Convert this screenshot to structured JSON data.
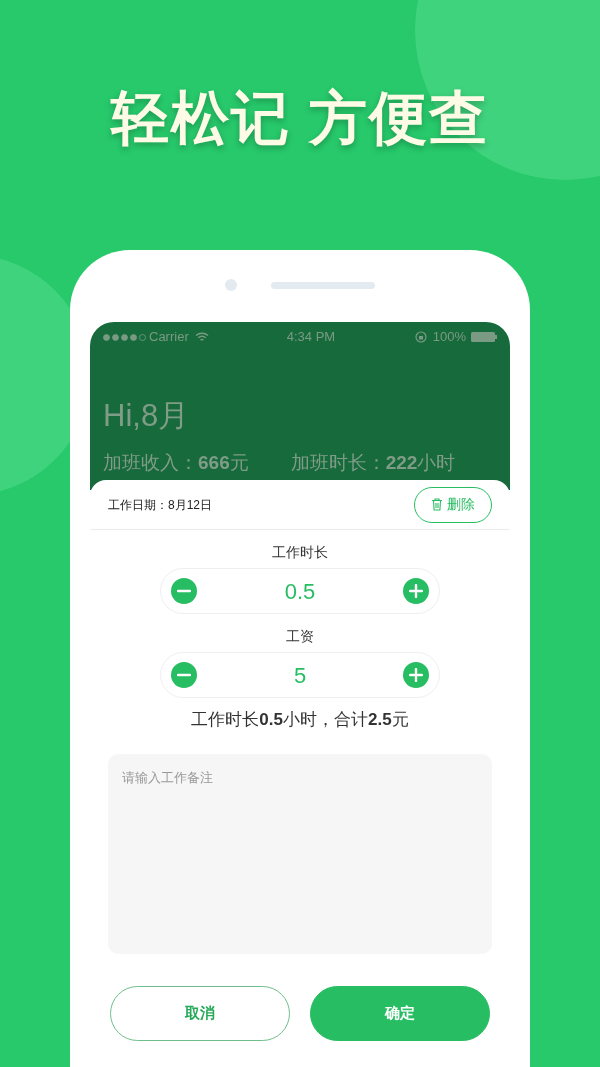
{
  "headline": "轻松记 方便查",
  "status_bar": {
    "carrier": "Carrier",
    "time": "4:34 PM",
    "battery": "100%"
  },
  "header": {
    "greeting": "Hi,8月",
    "stats": [
      "加班收入：**666**元",
      "加班时长：**222**小时"
    ]
  },
  "sheet": {
    "date": "工作日期：8月12日",
    "delete_button": "删除",
    "steppers": [
      {
        "label": "工作时长",
        "value": "0.5"
      },
      {
        "label": "工资",
        "value": "5"
      }
    ],
    "summary": "工作时长**0.5**小时，合计**2.5**元",
    "note": {
      "placeholder": "请输入工作备注"
    },
    "buttons": [
      {
        "label": "取消",
        "kind": "outline"
      },
      {
        "label": "确定",
        "kind": "filled"
      }
    ]
  }
}
